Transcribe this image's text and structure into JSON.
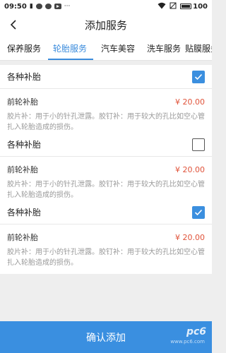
{
  "status_bar": {
    "time": "09:50",
    "battery": "100"
  },
  "header": {
    "title": "添加服务",
    "back_icon": "chevron-left-icon"
  },
  "tabs": [
    {
      "label": "保养服务",
      "active": false
    },
    {
      "label": "轮胎服务",
      "active": true
    },
    {
      "label": "汽车美容",
      "active": false
    },
    {
      "label": "洗车服务",
      "active": false
    },
    {
      "label": "贴膜服务",
      "active": false
    }
  ],
  "services": [
    {
      "title": "各种补胎",
      "checked": true,
      "item_name": "前轮补胎",
      "price": "¥ 20.00",
      "description": "胶片补：用于小的针孔泄露。胶钉补：用于较大的孔比如空心管扎入轮胎造成的损伤。"
    },
    {
      "title": "各种补胎",
      "checked": false,
      "item_name": "前轮补胎",
      "price": "¥ 20.00",
      "description": "胶片补：用于小的针孔泄露。胶钉补：用于较大的孔比如空心管扎入轮胎造成的损伤。"
    },
    {
      "title": "各种补胎",
      "checked": true,
      "item_name": "前轮补胎",
      "price": "¥ 20.00",
      "description": "胶片补：用于小的针孔泄露。胶钉补：用于较大的孔比如空心管扎入轮胎造成的损伤。"
    }
  ],
  "footer": {
    "confirm_label": "确认添加"
  },
  "watermark": {
    "logo": "pc6",
    "sub": "www.pc6.com"
  },
  "colors": {
    "accent": "#3a8fe0",
    "price": "#e0533a",
    "checkbox_checked": "#3b8fdf"
  }
}
